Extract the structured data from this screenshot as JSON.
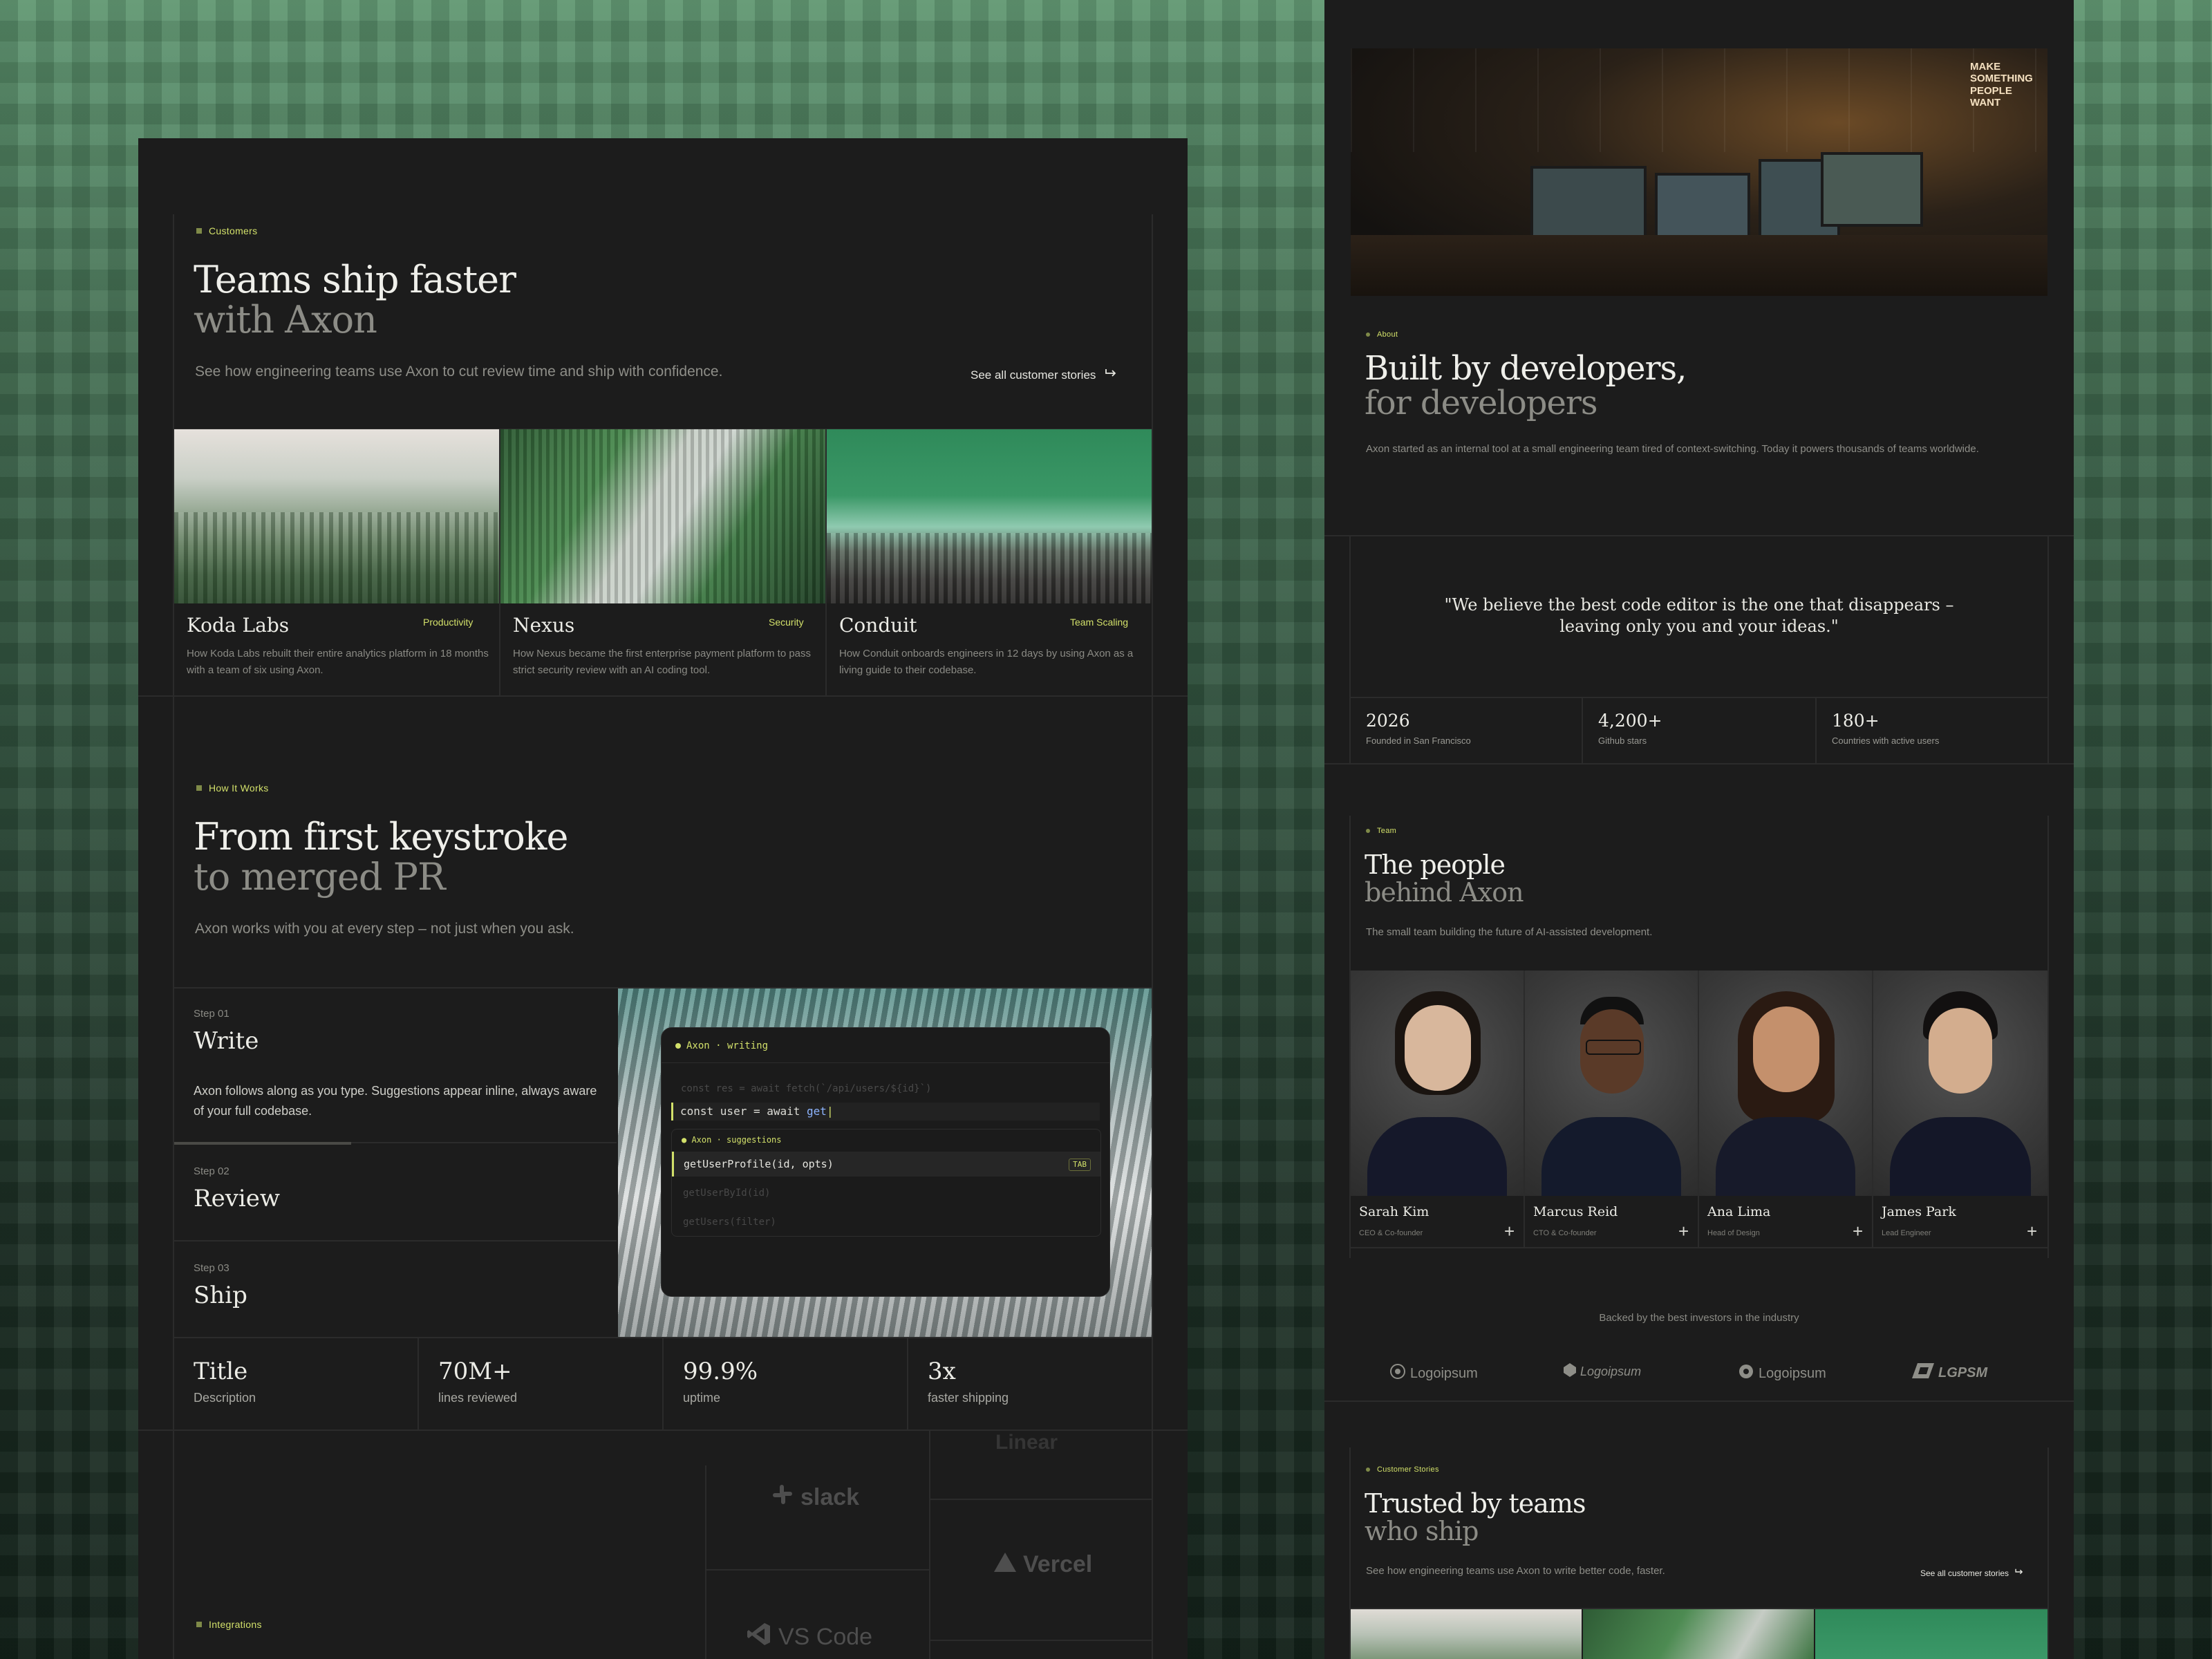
{
  "customers": {
    "eyebrow": "Customers",
    "title_line1": "Teams ship faster",
    "title_line2": "with Axon",
    "description": "See how engineering teams use Axon to cut review time and ship with confidence.",
    "link_label": "See all customer stories",
    "cards": [
      {
        "name": "Koda Labs",
        "tag": "Productivity",
        "desc": "How Koda Labs rebuilt their entire analytics platform in 18 months with a team of six using Axon."
      },
      {
        "name": "Nexus",
        "tag": "Security",
        "desc": "How Nexus became the first enterprise payment platform to pass strict security review with an AI coding tool."
      },
      {
        "name": "Conduit",
        "tag": "Team Scaling",
        "desc": "How Conduit onboards engineers in 12 days by using Axon as a living guide to their codebase."
      }
    ]
  },
  "how": {
    "eyebrow": "How It Works",
    "title_line1": "From first keystroke",
    "title_line2": "to merged PR",
    "description": "Axon works with you at every step – not just when you ask.",
    "steps": [
      {
        "label": "Step 01",
        "title": "Write",
        "desc": "Axon follows along as you type. Suggestions appear inline, always aware of your full codebase."
      },
      {
        "label": "Step 02",
        "title": "Review"
      },
      {
        "label": "Step 03",
        "title": "Ship"
      }
    ],
    "progress": 0.4
  },
  "editor": {
    "header": "Axon · writing",
    "line_faded": "const res = await fetch(`/api/users/${id}`)",
    "line_active_prefix": "const user = await",
    "line_active_fn": "get",
    "suggestions_header": "Axon · suggestions",
    "suggestion_main": "getUserProfile(id, opts)",
    "suggestion_key": "TAB",
    "suggestion_2": "getUserById(id)",
    "suggestion_3": "getUsers(filter)"
  },
  "stats": [
    {
      "value": "Title",
      "label": "Description"
    },
    {
      "value": "70M+",
      "label": "lines reviewed"
    },
    {
      "value": "99.9%",
      "label": "uptime"
    },
    {
      "value": "3x",
      "label": "faster shipping"
    }
  ],
  "integrations": {
    "eyebrow": "Integrations",
    "logos": [
      "slack",
      "Vercel",
      "VS Code",
      "Linear"
    ]
  },
  "about": {
    "eyebrow": "About",
    "title_line1": "Built by developers,",
    "title_line2": "for developers",
    "description": "Axon started as an internal tool at a small engineering team tired of context-switching. Today it powers thousands of teams worldwide.",
    "poster": [
      "MAKE",
      "SOMETHING",
      "PEOPLE",
      "WANT"
    ],
    "quote": "\"We believe the best code editor is the one that disappears – leaving only you and your ideas.\"",
    "stats": [
      {
        "value": "2026",
        "label": "Founded in San Francisco"
      },
      {
        "value": "4,200+",
        "label": "Github stars"
      },
      {
        "value": "180+",
        "label": "Countries with active users"
      }
    ]
  },
  "team": {
    "eyebrow": "Team",
    "title_line1": "The people",
    "title_line2": "behind Axon",
    "description": "The small team building the future of AI-assisted development.",
    "members": [
      {
        "name": "Sarah Kim",
        "role": "CEO & Co-founder"
      },
      {
        "name": "Marcus Reid",
        "role": "CTO & Co-founder"
      },
      {
        "name": "Ana Lima",
        "role": "Head of Design"
      },
      {
        "name": "James Park",
        "role": "Lead Engineer"
      }
    ]
  },
  "investors": {
    "heading": "Backed by the best investors in the industry",
    "logos": [
      "Logoipsum",
      "Logoipsum",
      "Logoipsum",
      "LGPSM"
    ]
  },
  "stories": {
    "eyebrow": "Customer Stories",
    "title_line1": "Trusted by teams",
    "title_line2": "who ship",
    "description": "See how engineering teams use Axon to write better code, faster.",
    "link_label": "See all customer stories"
  },
  "colors": {
    "accent": "#d2e06a",
    "panel": "#1c1c1c",
    "line": "#2b2b2b"
  }
}
